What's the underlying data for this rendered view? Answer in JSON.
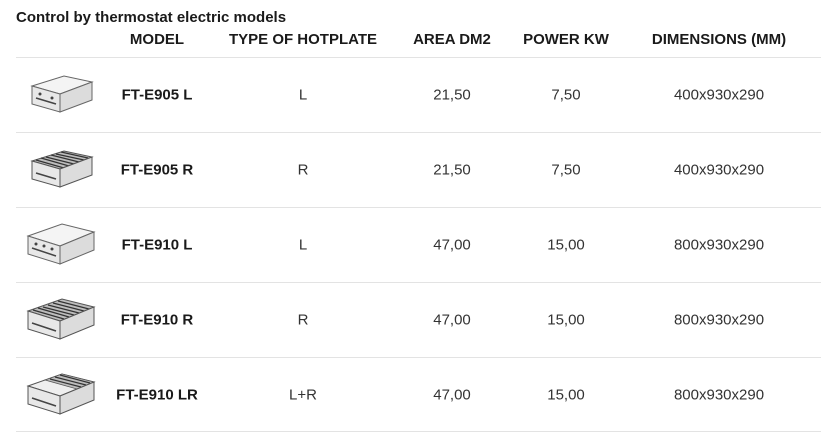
{
  "title": "Control by thermostat electric models",
  "headers": {
    "model": "MODEL",
    "type": "TYPE OF HOTPLATE",
    "area": "AREA DM2",
    "power": "POWER KW",
    "dimensions": "DIMENSIONS (MM)"
  },
  "rows": [
    {
      "image": "griddle-smooth-single-icon",
      "model": "FT-E905 L",
      "type": "L",
      "area": "21,50",
      "power": "7,50",
      "dimensions": "400x930x290"
    },
    {
      "image": "griddle-ribbed-single-icon",
      "model": "FT-E905 R",
      "type": "R",
      "area": "21,50",
      "power": "7,50",
      "dimensions": "400x930x290"
    },
    {
      "image": "griddle-smooth-double-icon",
      "model": "FT-E910 L",
      "type": "L",
      "area": "47,00",
      "power": "15,00",
      "dimensions": "800x930x290"
    },
    {
      "image": "griddle-ribbed-double-icon",
      "model": "FT-E910 R",
      "type": "R",
      "area": "47,00",
      "power": "15,00",
      "dimensions": "800x930x290"
    },
    {
      "image": "griddle-mixed-double-icon",
      "model": "FT-E910 LR",
      "type": "L+R",
      "area": "47,00",
      "power": "15,00",
      "dimensions": "800x930x290"
    }
  ]
}
